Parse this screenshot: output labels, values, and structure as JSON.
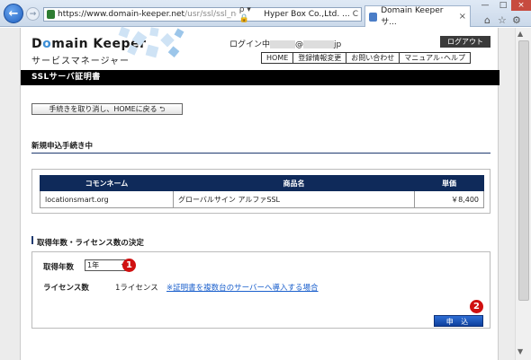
{
  "browser": {
    "url_host": "https://www.domain-keeper.net",
    "url_path": "/usr/ssl/ssl_neworder",
    "url_tools": "ρ ▾ 🔒",
    "cert_owner": "Hyper Box Co.,Ltd. ...",
    "cert_refresh": "C",
    "tab_title": "Domain Keeper サ...",
    "tab_close": "×",
    "back_icon": "←",
    "forward_icon": "→",
    "min": "—",
    "max": "□",
    "close": "×",
    "home_icon": "⌂",
    "star_icon": "☆",
    "gear_icon": "⚙"
  },
  "header": {
    "logo_title": "Dmain Keeper",
    "logo_title_o": "o",
    "logo_sub": "サービスマネージャー",
    "login_prefix": "ログイン中",
    "login_at": "@",
    "login_suffix": "jp",
    "logout": "ログアウト",
    "nav": [
      "HOME",
      "登録情報変更",
      "お問い合わせ",
      "マニュアル･ヘルプ"
    ]
  },
  "page": {
    "title": "SSLサーバ証明書",
    "cancel_button": "手続きを取り消し、HOMEに戻る ⮌",
    "section_new": "新規申込手続き中",
    "table": {
      "headers": [
        "コモンネーム",
        "商品名",
        "単価"
      ],
      "rows": [
        [
          "locationsmart.org",
          "グローバルサイン アルファSSL",
          "￥8,400"
        ]
      ]
    },
    "section_license": "取得年数・ライセンス数の決定",
    "year_label": "取得年数",
    "year_value": "1年",
    "year_arrow": "▾",
    "license_label": "ライセンス数",
    "license_value": "1ライセンス",
    "license_link": "※証明書を複数台のサーバーへ導入する場合",
    "submit": "申 込"
  },
  "markers": [
    "1",
    "2"
  ],
  "colors": {
    "navy": "#0f2a5a",
    "accent_blue": "#1a5fcc",
    "marker_red": "#d01010"
  }
}
